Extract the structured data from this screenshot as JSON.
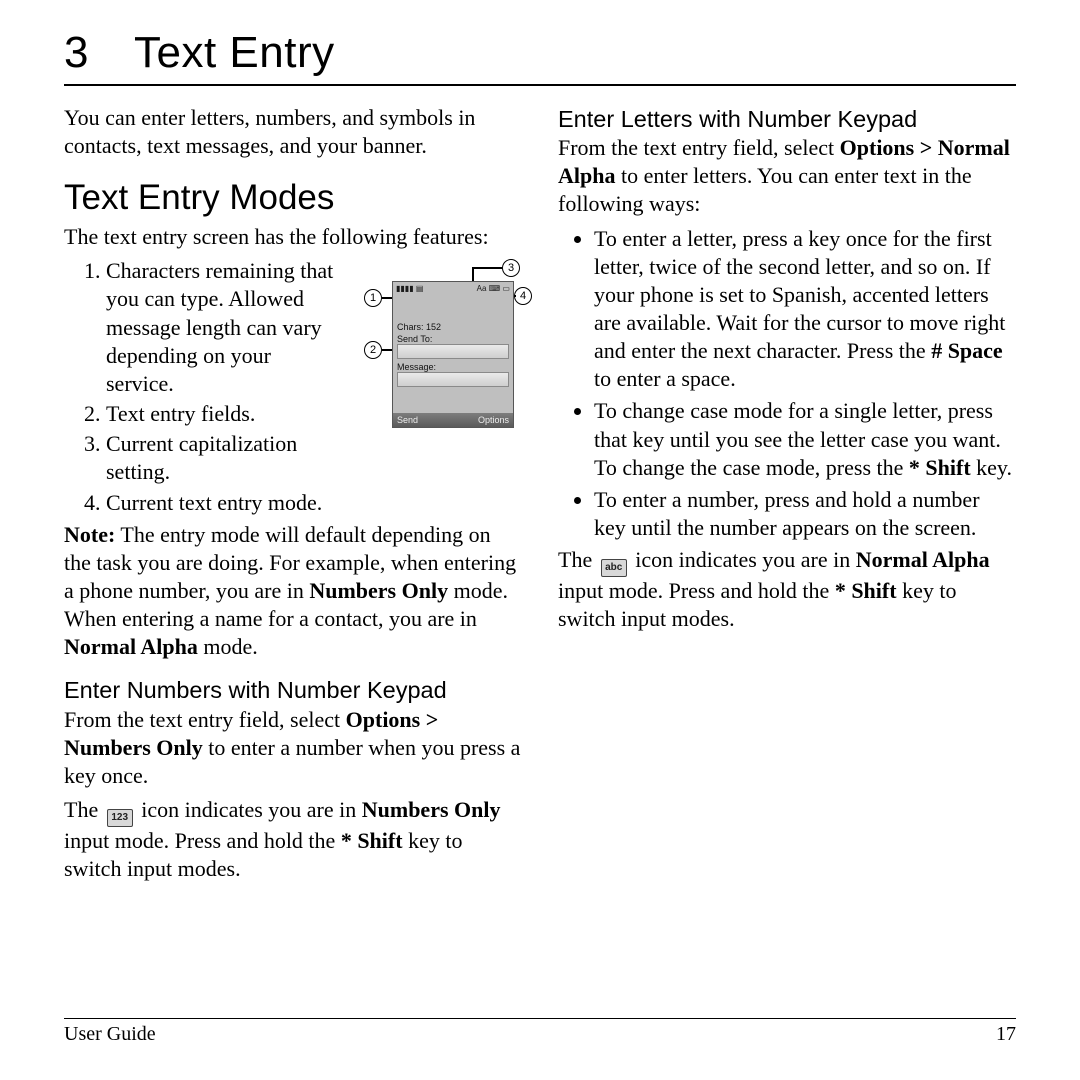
{
  "chapter": {
    "number": "3",
    "title": "Text Entry"
  },
  "intro": "You can enter letters, numbers, and symbols in contacts, text messages, and your banner.",
  "modes_section": {
    "heading": "Text Entry Modes",
    "lead": "The text entry screen has the following features:",
    "features": [
      "Characters remaining that you can type. Allowed message length can vary depending on your service.",
      "Text entry fields.",
      "Current capitalization setting.",
      "Current text entry mode."
    ],
    "note_label": "Note:",
    "note_text_1": " The entry mode will default depending on the task you are doing. For example, when entering a phone number, you are in ",
    "note_bold_1": "Numbers Only",
    "note_text_2": " mode. When entering a name for a contact, you are in ",
    "note_bold_2": "Normal Alpha",
    "note_text_3": " mode."
  },
  "figure": {
    "statusbar_left": "▮▮▮▮ ▤",
    "statusbar_right": "Aa ⌨ ▭",
    "chars_label": "Chars: 152",
    "sendto_label": "Send To:",
    "message_label": "Message:",
    "softkey_left": "Send",
    "softkey_right": "Options",
    "callouts": [
      "1",
      "2",
      "3",
      "4"
    ]
  },
  "numbers_section": {
    "heading": "Enter Numbers with Number Keypad",
    "p1a": "From the text entry field, select ",
    "p1b": "Options > Numbers Only",
    "p1c": " to enter a number when you press a key once.",
    "p2a": "The ",
    "icon_label": "123",
    "p2b": " icon indicates you are in ",
    "p2c": "Numbers Only",
    "p2d": " input mode. Press and hold the ",
    "p2e": "* Shift",
    "p2f": " key to switch input modes."
  },
  "letters_section": {
    "heading": "Enter Letters with Number Keypad",
    "p1a": "From the text entry field, select ",
    "p1b": "Options > Normal Alpha",
    "p1c": " to enter letters. You can enter text in the following ways:",
    "bullets": [
      {
        "t1": "To enter a letter, press a key once for the first letter, twice of the second letter, and so on. If your phone is set to Spanish, accented letters are available. Wait for the cursor to move right and enter the next character. Press the ",
        "b1": "# Space",
        "t2": " to enter a space."
      },
      {
        "t1": "To change case mode for a single letter, press that key until you see the letter case you want. To change the case mode, press the ",
        "b1": "* Shift",
        "t2": " key."
      },
      {
        "t1": "To enter a number, press and hold a number key until the number appears on the screen.",
        "b1": "",
        "t2": ""
      }
    ],
    "p2a": "The ",
    "icon_label": "abc",
    "p2b": " icon indicates you are in ",
    "p2c": "Normal Alpha",
    "p2d": " input mode. Press and hold the ",
    "p2e": "* Shift",
    "p2f": " key to switch input modes."
  },
  "footer": {
    "left": "User Guide",
    "right": "17"
  }
}
